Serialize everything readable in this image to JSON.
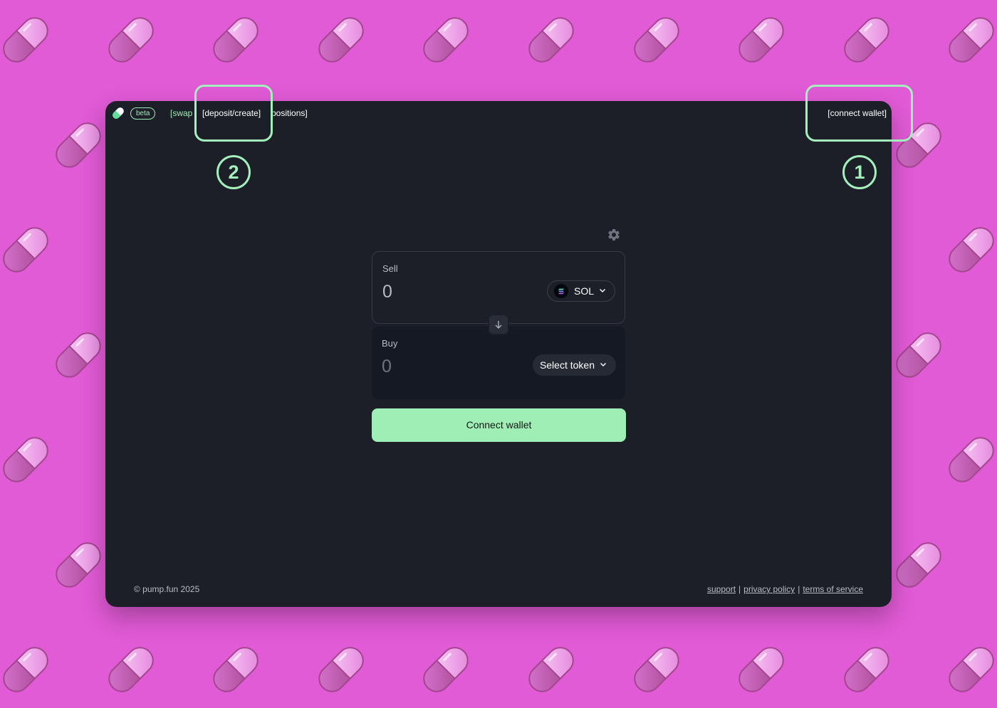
{
  "colors": {
    "background": "#e15ad6",
    "window": "#1c1f27",
    "accent": "#9cedb4",
    "highlight": "#a3f0bd",
    "pill": "#e58ee0"
  },
  "header": {
    "beta_label": "beta",
    "nav": {
      "swap": "[swap",
      "deposit_create": "[deposit/create]",
      "positions": "positions]"
    },
    "connect_wallet": "[connect wallet]"
  },
  "annotations": {
    "step_1": "1",
    "step_2": "2"
  },
  "swap": {
    "sell_label": "Sell",
    "sell_amount": "0",
    "sell_token": "SOL",
    "buy_label": "Buy",
    "buy_amount": "0",
    "select_token": "Select token",
    "connect_button": "Connect wallet"
  },
  "footer": {
    "copyright": "© pump.fun 2025",
    "support": "support",
    "privacy": "privacy policy",
    "terms": "terms of service",
    "separator": "|"
  }
}
